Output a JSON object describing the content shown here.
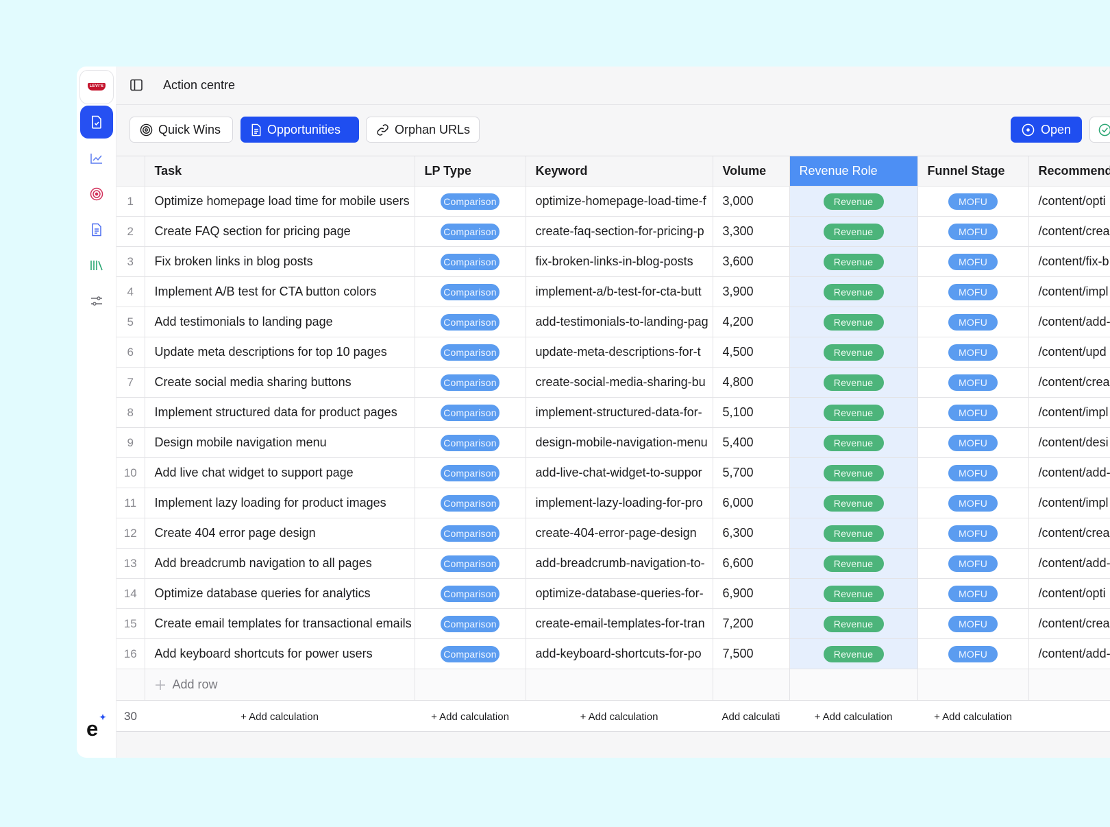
{
  "header": {
    "title": "Action centre"
  },
  "brand": {
    "logo_text": "LEVI'S",
    "mark": "e"
  },
  "sidebar": {
    "items": [
      {
        "icon": "document-check-icon",
        "active": true
      },
      {
        "icon": "line-chart-icon",
        "active": false
      },
      {
        "icon": "target-icon",
        "active": false
      },
      {
        "icon": "file-text-icon",
        "active": false
      },
      {
        "icon": "library-icon",
        "active": false
      },
      {
        "icon": "sliders-icon",
        "active": false
      }
    ]
  },
  "tabs": [
    {
      "label": "Quick Wins",
      "icon": "target-icon"
    },
    {
      "label": "Opportunities",
      "icon": "document-icon",
      "active": true
    },
    {
      "label": "Orphan URLs",
      "icon": "link-icon"
    }
  ],
  "actions": {
    "open_label": "Open"
  },
  "table": {
    "columns": [
      "Task",
      "LP Type",
      "Keyword",
      "Volume",
      "Revenue Role",
      "Funnel Stage",
      "Recommend"
    ],
    "rows": [
      [
        "1",
        "Optimize homepage load time for mobile users",
        "Comparison",
        "optimize-homepage-load-time-f",
        "3,000",
        "Revenue",
        "MOFU",
        "/content/opti"
      ],
      [
        "2",
        "Create FAQ section for pricing page",
        "Comparison",
        "create-faq-section-for-pricing-p",
        "3,300",
        "Revenue",
        "MOFU",
        "/content/crea"
      ],
      [
        "3",
        "Fix broken links in blog posts",
        "Comparison",
        "fix-broken-links-in-blog-posts",
        "3,600",
        "Revenue",
        "MOFU",
        "/content/fix-b"
      ],
      [
        "4",
        "Implement A/B test for CTA button colors",
        "Comparison",
        "implement-a/b-test-for-cta-butt",
        "3,900",
        "Revenue",
        "MOFU",
        "/content/impl"
      ],
      [
        "5",
        "Add testimonials to landing page",
        "Comparison",
        "add-testimonials-to-landing-pag",
        "4,200",
        "Revenue",
        "MOFU",
        "/content/add-"
      ],
      [
        "6",
        "Update meta descriptions for top 10 pages",
        "Comparison",
        "update-meta-descriptions-for-t",
        "4,500",
        "Revenue",
        "MOFU",
        "/content/upd"
      ],
      [
        "7",
        "Create social media sharing buttons",
        "Comparison",
        "create-social-media-sharing-bu",
        "4,800",
        "Revenue",
        "MOFU",
        "/content/crea"
      ],
      [
        "8",
        "Implement structured data for product pages",
        "Comparison",
        "implement-structured-data-for-",
        "5,100",
        "Revenue",
        "MOFU",
        "/content/impl"
      ],
      [
        "9",
        "Design mobile navigation menu",
        "Comparison",
        "design-mobile-navigation-menu",
        "5,400",
        "Revenue",
        "MOFU",
        "/content/desi"
      ],
      [
        "10",
        "Add live chat widget to support page",
        "Comparison",
        "add-live-chat-widget-to-suppor",
        "5,700",
        "Revenue",
        "MOFU",
        "/content/add-"
      ],
      [
        "11",
        "Implement lazy loading for product images",
        "Comparison",
        "implement-lazy-loading-for-pro",
        "6,000",
        "Revenue",
        "MOFU",
        "/content/impl"
      ],
      [
        "12",
        "Create 404 error page design",
        "Comparison",
        "create-404-error-page-design",
        "6,300",
        "Revenue",
        "MOFU",
        "/content/crea"
      ],
      [
        "13",
        "Add breadcrumb navigation to all pages",
        "Comparison",
        "add-breadcrumb-navigation-to-",
        "6,600",
        "Revenue",
        "MOFU",
        "/content/add-"
      ],
      [
        "14",
        "Optimize database queries for analytics",
        "Comparison",
        "optimize-database-queries-for-",
        "6,900",
        "Revenue",
        "MOFU",
        "/content/opti"
      ],
      [
        "15",
        "Create email templates for transactional emails",
        "Comparison",
        "create-email-templates-for-tran",
        "7,200",
        "Revenue",
        "MOFU",
        "/content/crea"
      ],
      [
        "16",
        "Add keyboard shortcuts for power users",
        "Comparison",
        "add-keyboard-shortcuts-for-po",
        "7,500",
        "Revenue",
        "MOFU",
        "/content/add-"
      ]
    ],
    "add_row_label": "Add row",
    "footer": {
      "count": "30",
      "calc_labels": [
        "+ Add calculation",
        "+ Add calculation",
        "+ Add calculation",
        "Add calculati",
        "+ Add calculation",
        "+ Add calculation"
      ]
    }
  },
  "colors": {
    "accent": "#1f4ef0",
    "revenue_header": "#4d8ff4",
    "revenue_column_bg": "#e6effd",
    "pill_blue": "#5b9cf0",
    "pill_green": "#4cb47a",
    "background": "#e2fbfe"
  }
}
